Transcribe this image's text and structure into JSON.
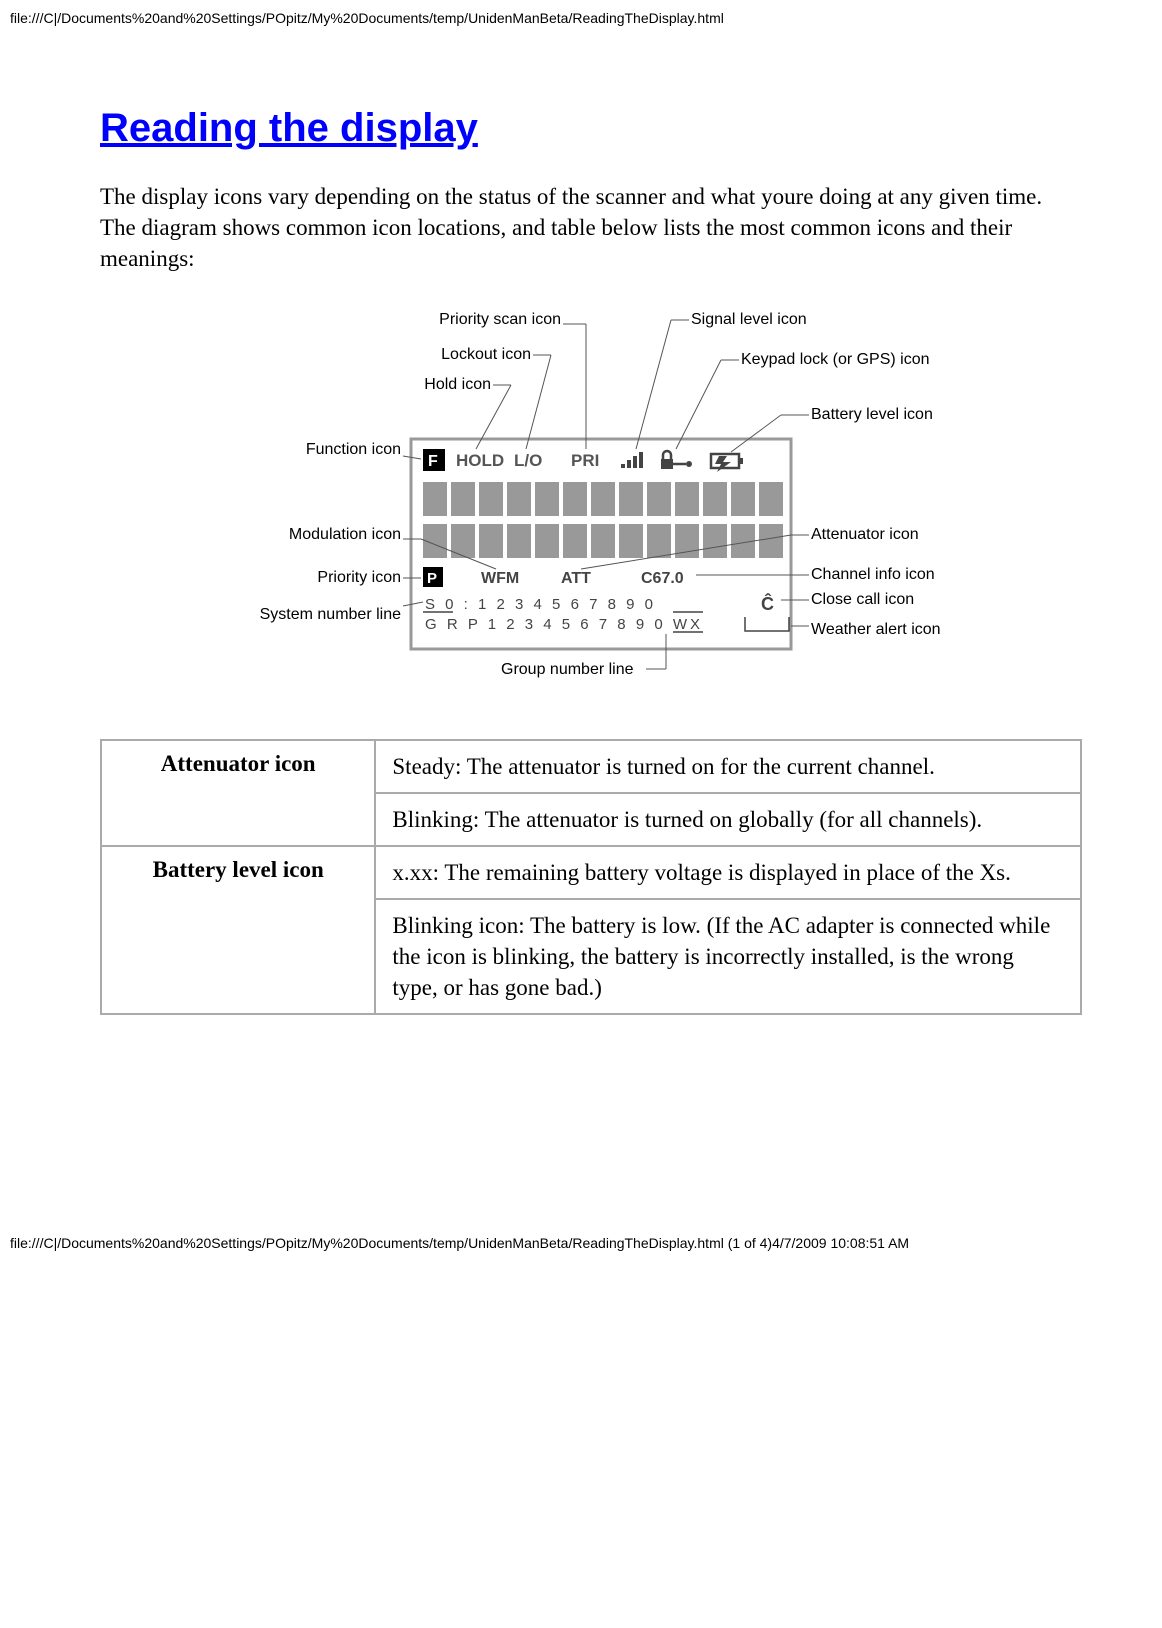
{
  "header_url": "file:///C|/Documents%20and%20Settings/POpitz/My%20Documents/temp/UnidenManBeta/ReadingTheDisplay.html",
  "title": "Reading the display",
  "intro": "The display icons vary depending on the status of the scanner and what youre doing at any given time. The diagram shows common icon locations, and table below lists the most common icons and their meanings:",
  "diagram": {
    "labels_left": [
      "Priority scan icon",
      "Lockout icon",
      "Hold icon",
      "Function icon",
      "Modulation icon",
      "Priority icon",
      "System number line"
    ],
    "labels_right": [
      "Signal level icon",
      "Keypad lock (or GPS) icon",
      "Battery level icon",
      "Attenuator icon",
      "Channel info icon",
      "Close call icon",
      "Weather alert icon"
    ],
    "bottom_label": "Group number line",
    "lcd_row1": [
      "F",
      "HOLD",
      "L/O",
      "PRI",
      "signal",
      "lock",
      "battery"
    ],
    "lcd_row3": [
      "P",
      "WFM",
      "ATT",
      "C67.0"
    ],
    "lcd_row4": "S 0 : 1 2 3 4 5 6 7 8 9 0",
    "lcd_row5": "G R P 1 2 3 4 5 6 7 8 9 0  WX",
    "close_call_glyph": "Ĉ"
  },
  "table": {
    "rows": [
      {
        "name": "Attenuator icon",
        "descs": [
          "Steady: The attenuator is turned on for the current channel.",
          "Blinking: The attenuator is turned on globally (for all channels)."
        ]
      },
      {
        "name": "Battery level icon",
        "descs": [
          "x.xx: The remaining battery voltage is displayed in place of the Xs.",
          "Blinking icon: The battery is low. (If the AC adapter is connected while the icon is blinking, the battery is incorrectly installed, is the wrong type, or has gone bad.)"
        ]
      }
    ]
  },
  "footer": "file:///C|/Documents%20and%20Settings/POpitz/My%20Documents/temp/UnidenManBeta/ReadingTheDisplay.html (1 of 4)4/7/2009 10:08:51 AM"
}
